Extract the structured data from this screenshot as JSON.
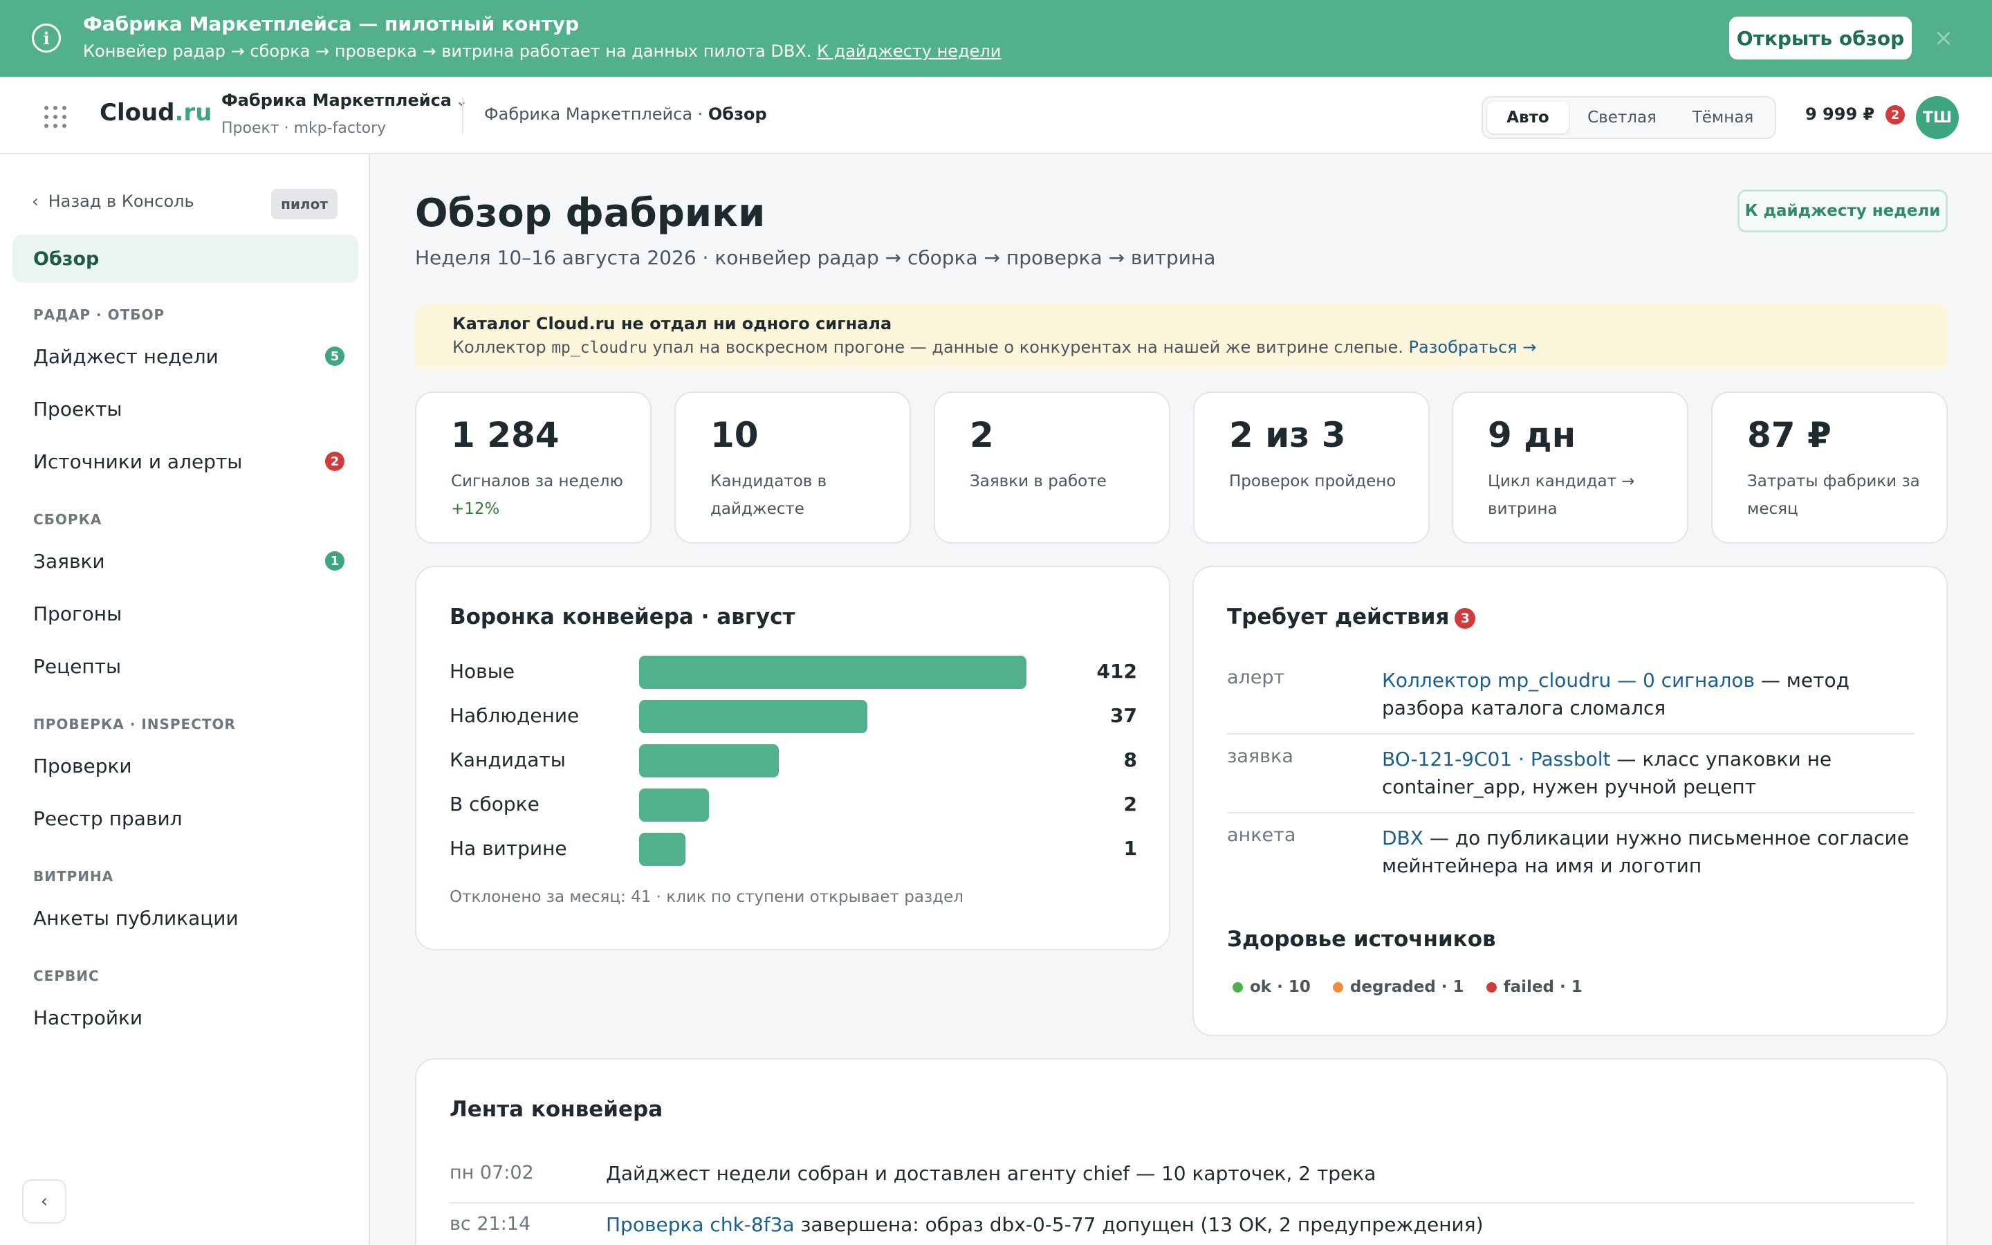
{
  "banner": {
    "title": "Фабрика Маркетплейса — пилотный контур",
    "text": "Конвейер радар → сборка → проверка → витрина работает на данных пилота DBX.",
    "link": "К дайджесту недели",
    "button": "Открыть обзор",
    "close": "×"
  },
  "header": {
    "logo_main": "Cloud",
    "logo_tld": ".ru",
    "project_name": "Фабрика Маркетплейса",
    "project_sub": "Проект · mkp-factory",
    "breadcrumb_parent": "Фабрика Маркетплейса · ",
    "breadcrumb_current": "Обзор",
    "theme_options": [
      "Авто",
      "Светлая",
      "Тёмная"
    ],
    "theme_selected": "Авто",
    "balance": "9 999 ₽",
    "notifications": "2",
    "avatar": "ТШ"
  },
  "sidebar": {
    "back": "Назад в Консоль",
    "badge": "пилот",
    "overview": "Обзор",
    "sections": [
      {
        "title": "РАДАР · ОТБОР",
        "items": [
          {
            "label": "Дайджест недели",
            "count": "5",
            "count_color": "green"
          },
          {
            "label": "Проекты"
          },
          {
            "label": "Источники и алерты",
            "count": "2",
            "count_color": "red"
          }
        ]
      },
      {
        "title": "СБОРКА",
        "items": [
          {
            "label": "Заявки",
            "count": "1",
            "count_color": "green"
          },
          {
            "label": "Прогоны"
          },
          {
            "label": "Рецепты"
          }
        ]
      },
      {
        "title": "ПРОВЕРКА · INSPECTOR",
        "items": [
          {
            "label": "Проверки"
          },
          {
            "label": "Реестр правил"
          }
        ]
      },
      {
        "title": "ВИТРИНА",
        "items": [
          {
            "label": "Анкеты публикации"
          }
        ]
      },
      {
        "title": "СЕРВИС",
        "items": [
          {
            "label": "Настройки"
          }
        ]
      }
    ],
    "collapse": "‹"
  },
  "main": {
    "title": "Обзор фабрики",
    "subtitle": "Неделя 10–16 августа 2026 · конвейер радар → сборка → проверка → витрина",
    "digest_button": "К дайджесту недели",
    "alert": {
      "title": "Каталог Cloud.ru не отдал ни одного сигнала",
      "text_before": "Коллектор ",
      "code": "mp_cloudru",
      "text_after": " упал на воскресном прогоне — данные о конкурентах на нашей же витрине слепые. ",
      "link": "Разобраться →"
    },
    "kpis": [
      {
        "value": "1 284",
        "label": "Сигналов за неделю",
        "delta": "+12%"
      },
      {
        "value": "10",
        "label": "Кандидатов в дайджесте"
      },
      {
        "value": "2",
        "label": "Заявки в работе"
      },
      {
        "value": "2 из 3",
        "label": "Проверок пройдено"
      },
      {
        "value": "9 дн",
        "label": "Цикл кандидат → витрина"
      },
      {
        "value": "87 ₽",
        "label": "Затраты фабрики за месяц"
      }
    ],
    "funnel": {
      "title": "Воронка конвейера · август",
      "stages": [
        {
          "label": "Новые",
          "value": 412
        },
        {
          "label": "Наблюдение",
          "value": 37
        },
        {
          "label": "Кандидаты",
          "value": 8
        },
        {
          "label": "В сборке",
          "value": 2
        },
        {
          "label": "На витрине",
          "value": 1
        }
      ],
      "bar_fill": [
        1.0,
        0.59,
        0.36,
        0.18,
        0.12
      ],
      "footnote": "Отклонено за месяц: 41 · клик по ступени открывает раздел"
    },
    "actions": {
      "title": "Требует действия",
      "count": "3",
      "items": [
        {
          "kind": "алерт",
          "link": "Коллектор mp_cloudru — 0 сигналов",
          "text": " — метод разбора каталога сломался"
        },
        {
          "kind": "заявка",
          "link": "BO-121-9C01 · Passbolt",
          "text": " — класс упаковки не container_app, нужен ручной рецепт"
        },
        {
          "kind": "анкета",
          "link": "DBX",
          "text": " — до публикации нужно письменное согласие мейнтейнера на имя и логотип"
        }
      ],
      "health_title": "Здоровье источников",
      "health": [
        {
          "label": "ok · 10",
          "color": "#4caf50"
        },
        {
          "label": "degraded · 1",
          "color": "#f08c3a"
        },
        {
          "label": "failed · 1",
          "color": "#d23b3b"
        }
      ]
    },
    "feed": {
      "title": "Лента конвейера",
      "items": [
        {
          "time": "пн 07:02",
          "link": "",
          "text": "Дайджест недели собран и доставлен агенту chief — 10 карточек, 2 трека"
        },
        {
          "time": "вс 21:14",
          "link": "Проверка chk-8f3a",
          "text": " завершена: образ dbx-0-5-77 допущен (13 OK, 2 предупреждения)"
        }
      ]
    }
  }
}
